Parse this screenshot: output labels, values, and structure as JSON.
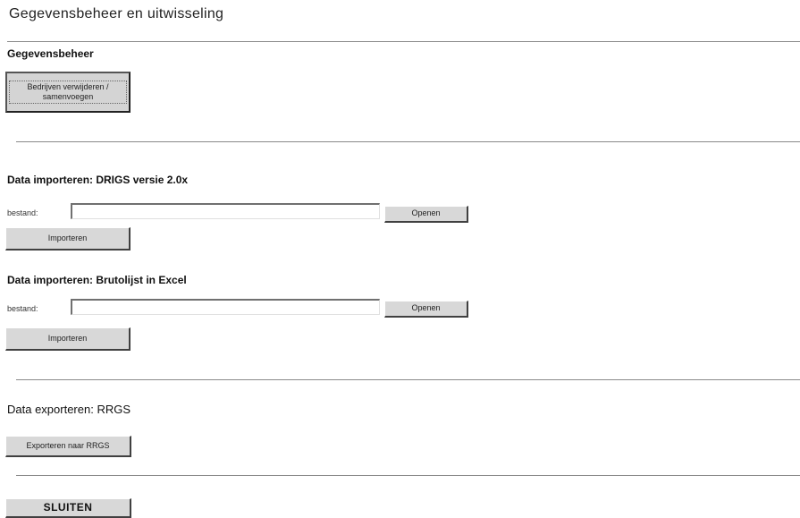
{
  "page": {
    "title": "Gegevensbeheer en uitwisseling"
  },
  "data_management": {
    "heading": "Gegevensbeheer",
    "delete_merge_button": "Bedrijven verwijderen / samenvoegen"
  },
  "import_drigs": {
    "heading": "Data importeren: DRIGS versie 2.0x",
    "file_label": "bestand:",
    "file_value": "",
    "open_button": "Openen",
    "import_button": "Importeren"
  },
  "import_excel": {
    "heading": "Data importeren: Brutolijst in Excel",
    "file_label": "bestand:",
    "file_value": "",
    "open_button": "Openen",
    "import_button": "Importeren"
  },
  "export_rrgs": {
    "heading": "Data exporteren: RRGS",
    "export_button": "Exporteren naar RRGS"
  },
  "footer": {
    "close_button": "SLUITEN"
  }
}
